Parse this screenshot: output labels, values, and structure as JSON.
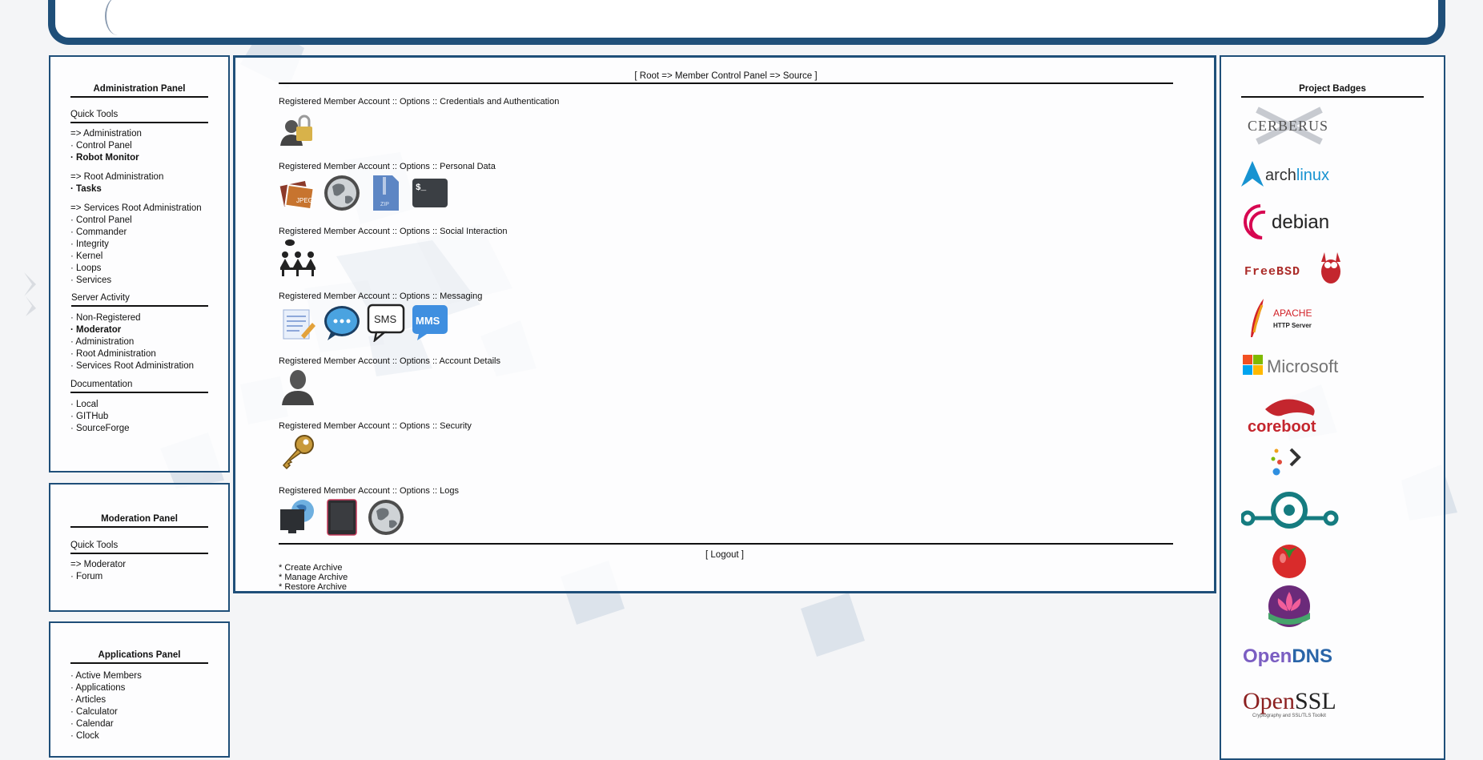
{
  "admin_panel": {
    "title": "Administration Panel",
    "quick_tools": "Quick Tools",
    "admin_group": [
      "=> Administration",
      "· Control Panel",
      "· Robot Monitor"
    ],
    "root_group": [
      "=> Root Administration",
      "· Tasks"
    ],
    "services_group": [
      "=> Services Root Administration",
      "· Control Panel",
      "· Commander",
      "· Integrity",
      "· Kernel",
      "· Loops",
      "· Services"
    ],
    "server_activity": "Server Activity",
    "activity": [
      "· Non-Registered",
      "· Moderator",
      "· Administration",
      "· Root Administration",
      "· Services Root Administration"
    ],
    "documentation": "Documentation",
    "docs": [
      "· Local",
      "· GITHub",
      "· SourceForge"
    ]
  },
  "moderation_panel": {
    "title": "Moderation Panel",
    "quick_tools": "Quick Tools",
    "items": [
      "=> Moderator",
      "· Forum"
    ]
  },
  "applications_panel": {
    "title": "Applications Panel",
    "items": [
      "· Active Members",
      "· Applications",
      "· Articles",
      "· Calculator",
      "· Calendar",
      "· Clock"
    ]
  },
  "main": {
    "breadcrumb": "[ Root => Member Control Panel => Source ]",
    "sections": [
      {
        "label": "Registered Member Account :: Options :: Credentials and Authentication",
        "icons": [
          "user-lock-icon"
        ]
      },
      {
        "label": "Registered Member Account :: Options :: Personal Data",
        "icons": [
          "photos-icon",
          "globe-icon",
          "zip-icon",
          "terminal-icon"
        ]
      },
      {
        "label": "Registered Member Account :: Options :: Social Interaction",
        "icons": [
          "meeting-icon"
        ]
      },
      {
        "label": "Registered Member Account :: Options :: Messaging",
        "icons": [
          "notepad-icon",
          "chat-bubble-icon",
          "sms-icon",
          "mms-icon"
        ]
      },
      {
        "label": "Registered Member Account :: Options :: Account Details",
        "icons": [
          "user-silhouette-icon"
        ]
      },
      {
        "label": "Registered Member Account :: Options :: Security",
        "icons": [
          "key-icon"
        ]
      },
      {
        "label": "Registered Member Account :: Options :: Logs",
        "icons": [
          "monitor-globe-icon",
          "tablet-icon",
          "globe-icon"
        ]
      }
    ],
    "sms_text": "SMS",
    "mms_text": "MMS",
    "terminal_text": "$_",
    "logout": "[ Logout ]",
    "archive": [
      "* Create Archive",
      "* Manage Archive",
      "* Restore Archive"
    ]
  },
  "badges_panel": {
    "title": "Project Badges",
    "badges": [
      {
        "name": "cerberus-badge",
        "text": "CERBERUS"
      },
      {
        "name": "archlinux-badge",
        "text_a": "arch",
        "text_b": "linux"
      },
      {
        "name": "debian-badge",
        "text": "debian"
      },
      {
        "name": "freebsd-badge",
        "text": "FreeBSD"
      },
      {
        "name": "apache-badge",
        "text_a": "APACHE",
        "text_b": "HTTP Server"
      },
      {
        "name": "microsoft-badge",
        "text": "Microsoft"
      },
      {
        "name": "coreboot-badge",
        "text": "coreboot"
      },
      {
        "name": "next-badge",
        "text": ""
      },
      {
        "name": "lineage-badge",
        "text": ""
      },
      {
        "name": "tomato-badge",
        "text": ""
      },
      {
        "name": "lotus-badge",
        "text": ""
      },
      {
        "name": "opendns-badge",
        "text_a": "Open",
        "text_b": "DNS"
      },
      {
        "name": "openssl-badge",
        "text_a": "Open",
        "text_b": "SSL",
        "text_c": "Cryptography and SSL/TLS Toolkit"
      }
    ]
  },
  "colors": {
    "frame": "#1f4f79",
    "rule": "#111111",
    "arch": "#1793d1",
    "debian": "#d70751",
    "freebsd": "#ab2b28",
    "coreboot": "#c4262e",
    "opendns": "#5b4bb7"
  }
}
